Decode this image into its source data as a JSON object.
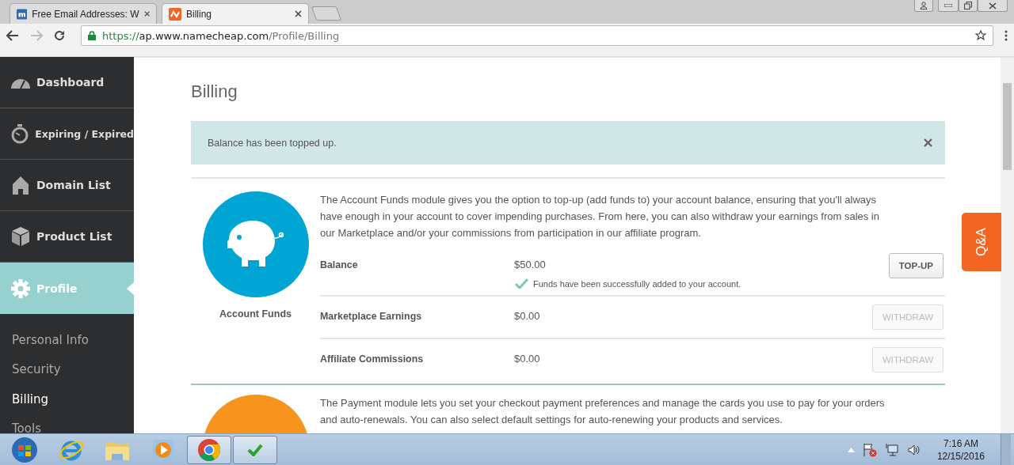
{
  "browser": {
    "tabs": [
      {
        "title": "Free Email Addresses: W",
        "selected": false
      },
      {
        "title": "Billing",
        "selected": true
      }
    ],
    "url": {
      "scheme": "https://",
      "host": "ap.www.namecheap.com",
      "path": "/Profile/Billing"
    }
  },
  "sidebar": {
    "items": [
      {
        "label": "Dashboard",
        "selected": false
      },
      {
        "label": "Expiring / Expired",
        "selected": false
      },
      {
        "label": "Domain List",
        "selected": false
      },
      {
        "label": "Product List",
        "selected": false
      },
      {
        "label": "Profile",
        "selected": true
      }
    ],
    "subitems": [
      {
        "label": "Personal Info",
        "selected": false
      },
      {
        "label": "Security",
        "selected": false
      },
      {
        "label": "Billing",
        "selected": true
      },
      {
        "label": "Tools",
        "selected": false
      }
    ]
  },
  "page": {
    "title": "Billing",
    "alert": {
      "message": "Balance has been topped up."
    },
    "modules": [
      {
        "color": "#00a5d3",
        "label": "Account Funds",
        "description": "The Account Funds module gives you the option to top-up (add funds to) your account balance, ensuring that you'll always have enough in your account to cover impending purchases. From here, you can also withdraw your earnings from sales in our Marketplace and/or your commissions from participation in our affiliate program.",
        "rows": [
          {
            "label": "Balance",
            "value": "$50.00",
            "note": "Funds have been successfully added to your account.",
            "button": {
              "label": "TOP-UP",
              "disabled": false
            }
          },
          {
            "label": "Marketplace Earnings",
            "value": "$0.00",
            "button": {
              "label": "WITHDRAW",
              "disabled": true
            }
          },
          {
            "label": "Affiliate Commissions",
            "value": "$0.00",
            "button": {
              "label": "WITHDRAW",
              "disabled": true
            }
          }
        ]
      },
      {
        "color": "#f7941d",
        "description": "The Payment module lets you set your checkout payment preferences and manage the cards you use to pay for your orders and auto-renewals. You can also select default settings for auto-renewing your products and services."
      }
    ]
  },
  "qa_tab": {
    "label": "Q&A"
  },
  "taskbar": {
    "apps": [
      {
        "kind": "ie",
        "selected": false
      },
      {
        "kind": "folder",
        "selected": false
      },
      {
        "kind": "media",
        "selected": false
      },
      {
        "kind": "chrome",
        "selected": true
      },
      {
        "kind": "check",
        "selected": true
      }
    ],
    "time": "7:16 AM",
    "date": "12/15/2016"
  }
}
